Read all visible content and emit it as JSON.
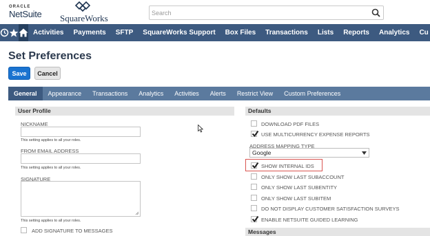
{
  "header": {
    "oracle_label": "ORACLE",
    "netsuite_label": "NetSuite",
    "squareworks_label": "SquareWorks",
    "search_placeholder": "Search"
  },
  "nav": {
    "items": [
      "Activities",
      "Payments",
      "SFTP",
      "SquareWorks Support",
      "Box Files",
      "Transactions",
      "Lists",
      "Reports",
      "Analytics",
      "Cu"
    ]
  },
  "page": {
    "title": "Set Preferences",
    "save_label": "Save",
    "cancel_label": "Cancel"
  },
  "tabs": {
    "items": [
      "General",
      "Appearance",
      "Transactions",
      "Analytics",
      "Activities",
      "Alerts",
      "Restrict View",
      "Custom Preferences"
    ]
  },
  "user_profile": {
    "heading": "User Profile",
    "nickname_label": "NICKNAME",
    "nickname_help": "This setting applies to all your roles.",
    "email_label": "FROM EMAIL ADDRESS",
    "email_help": "This setting applies to all your roles.",
    "signature_label": "SIGNATURE",
    "signature_help": "This setting applies to all your roles.",
    "add_signature_label": "ADD SIGNATURE TO MESSAGES"
  },
  "defaults": {
    "heading": "Defaults",
    "download_pdf": "DOWNLOAD PDF FILES",
    "multicurrency": "USE MULTICURRENCY EXPENSE REPORTS",
    "address_mapping_label": "ADDRESS MAPPING TYPE",
    "address_mapping_value": "Google",
    "show_internal_ids": "SHOW INTERNAL IDS",
    "last_subaccount": "ONLY SHOW LAST SUBACCOUNT",
    "last_subentity": "ONLY SHOW LAST SUBENTITY",
    "last_subitem": "ONLY SHOW LAST SUBITEM",
    "no_surveys": "DO NOT DISPLAY CUSTOMER SATISFACTION SURVEYS",
    "guided_learning": "ENABLE NETSUITE GUIDED LEARNING",
    "messages_heading": "Messages"
  },
  "colors": {
    "nav_bg": "#3d5a80",
    "tab_bg": "#5b7a9e",
    "save_blue": "#1a73d0",
    "highlight_red": "#d9534f"
  }
}
